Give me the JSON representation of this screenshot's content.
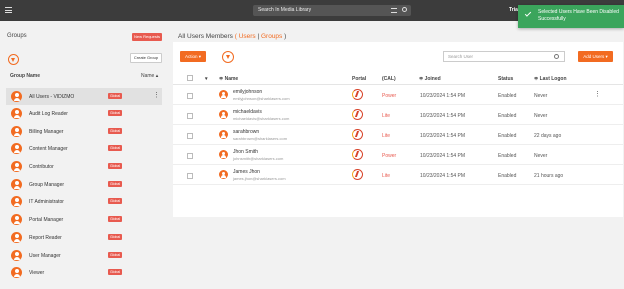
{
  "topbar": {
    "search_placeholder": "Search In Media Library",
    "user_name": "Trial",
    "toast_message": "Selected Users Have Been Disabled Successfully"
  },
  "left": {
    "title": "Groups",
    "new_requests": "New Requests",
    "create_group": "Create Group",
    "col_name": "Group Name",
    "col_sort": "Name ▴",
    "groups": [
      {
        "name": "All Users - VIDIZMO",
        "badge": "Global"
      },
      {
        "name": "Audit Log Reader",
        "badge": "Global"
      },
      {
        "name": "Billing Manager",
        "badge": "Global"
      },
      {
        "name": "Content Manager",
        "badge": "Global"
      },
      {
        "name": "Contributor",
        "badge": "Global"
      },
      {
        "name": "Group Manager",
        "badge": "Global"
      },
      {
        "name": "IT Administrator",
        "badge": "Global"
      },
      {
        "name": "Portal Manager",
        "badge": "Global"
      },
      {
        "name": "Report Reader",
        "badge": "Global"
      },
      {
        "name": "User Manager",
        "badge": "Global"
      },
      {
        "name": "Viewer",
        "badge": "Global"
      }
    ]
  },
  "main": {
    "title_prefix": "All Users Members",
    "title_link": "( Users",
    "title_sep": " | ",
    "title_link2": "Groups",
    "title_suffix": " )",
    "action_label": "Action ▾",
    "search_placeholder": "Search User",
    "add_users": "Add Users ▾",
    "columns": {
      "sort_caret": "▾",
      "name": "≑ Name",
      "portal": "Portal",
      "cal": "(CAL)",
      "joined": "≑ Joined",
      "status": "Status",
      "last_logon": "≑ Last Logon"
    },
    "users": [
      {
        "name": "emilyjohnson",
        "email": "emilyjohnson@sharklasers.com",
        "cal": "Power",
        "joined": "10/23/2024 1:54 PM",
        "status": "Enabled",
        "last_logon": "Never"
      },
      {
        "name": "michaeldavis",
        "email": "michaeldavis@sharklasers.com",
        "cal": "Lite",
        "joined": "10/23/2024 1:54 PM",
        "status": "Enabled",
        "last_logon": "Never"
      },
      {
        "name": "sarahbrown",
        "email": "sarahbrown@sharklasers.com",
        "cal": "Lite",
        "joined": "10/23/2024 1:54 PM",
        "status": "Enabled",
        "last_logon": "22 days ago"
      },
      {
        "name": "Jhon Smith",
        "email": "johnsmith@sharklasers.com",
        "cal": "Power",
        "joined": "10/23/2024 1:54 PM",
        "status": "Enabled",
        "last_logon": "Never"
      },
      {
        "name": "James Jhon",
        "email": "james.jhon@sharklasers.com",
        "cal": "Lite",
        "joined": "10/23/2024 1:54 PM",
        "status": "Enabled",
        "last_logon": "21 hours ago"
      }
    ],
    "more_icon": "⋮"
  },
  "colors": {
    "accent": "#f26b21",
    "badge": "#e85a4f",
    "toast": "#3ba55c",
    "topbar": "#3c3c3c"
  }
}
